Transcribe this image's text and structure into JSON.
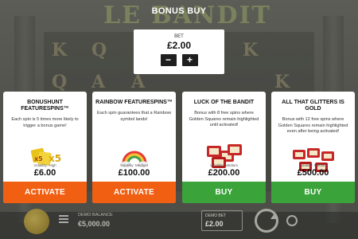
{
  "header": {
    "title": "BONUS BUY",
    "game_logo": "LE BANDIT"
  },
  "bet_panel": {
    "label": "BET",
    "value": "£2.00",
    "minus": "−",
    "plus": "+"
  },
  "cards": [
    {
      "title": "BONUSHUNT FEATURESPINS™",
      "description": "Each spin is 5 times more likely to trigger a bonus game!",
      "art": "x5-multiplier-icon",
      "volatility": "Volatility: High",
      "price": "£6.00",
      "button": "ACTIVATE",
      "button_color": "#f15f13"
    },
    {
      "title": "RAINBOW FEATURESPINS™",
      "description": "Each spin guarantees that a Rainbow symbol lands!",
      "art": "rainbow-icon",
      "volatility": "Volatility: Medium",
      "price": "£100.00",
      "button": "ACTIVATE",
      "button_color": "#f15f13"
    },
    {
      "title": "LUCK OF THE BANDIT",
      "description": "Bonus with 8 free spins where Golden Squares remain highlighted until activated!",
      "art": "scatter-symbols-icon",
      "volatility": "Volatility: Medium",
      "price": "£200.00",
      "button": "BUY",
      "button_color": "#3aa33a"
    },
    {
      "title": "ALL THAT GLITTERS IS GOLD",
      "description": "Bonus with 12 free spins where Golden Squares remain highlighted even after being activated!",
      "art": "scatter-symbols-icon",
      "volatility": "Volatility: Medium",
      "price": "£500.00",
      "button": "BUY",
      "button_color": "#3aa33a"
    }
  ],
  "bottom_bar": {
    "balance_label": "DEMO BALANCE",
    "balance_value": "€5,000.00",
    "bet_label": "DEMO BET",
    "bet_value": "£2.00"
  }
}
